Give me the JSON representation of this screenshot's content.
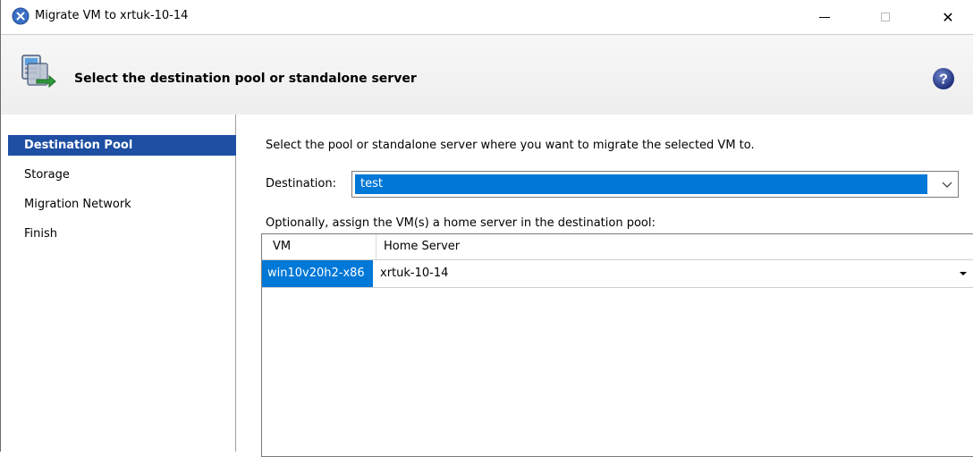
{
  "window": {
    "title": "Migrate VM to xrtuk-10-14",
    "close_glyph": "✕"
  },
  "header": {
    "title": "Select the destination pool or standalone server",
    "icon": "migrate-vm-icon",
    "help_icon": "help-icon",
    "help_glyph": "?"
  },
  "nav": {
    "items": [
      {
        "label": "Destination Pool",
        "selected": true
      },
      {
        "label": "Storage",
        "selected": false
      },
      {
        "label": "Migration Network",
        "selected": false
      },
      {
        "label": "Finish",
        "selected": false
      }
    ]
  },
  "main": {
    "instruction": "Select the pool or standalone server where you want to migrate the selected VM to.",
    "destination_label": "Destination:",
    "destination_value": "test",
    "optional_text": "Optionally, assign the VM(s) a home server in the destination pool:",
    "grid": {
      "columns": [
        "VM",
        "Home Server"
      ],
      "rows": [
        {
          "vm": "win10v20h2-x86",
          "home_server": "xrtuk-10-14"
        }
      ]
    }
  },
  "colors": {
    "selection_blue": "#0078d7",
    "nav_selected": "#1e4fa3",
    "header_bg": "#f2f2f2"
  }
}
